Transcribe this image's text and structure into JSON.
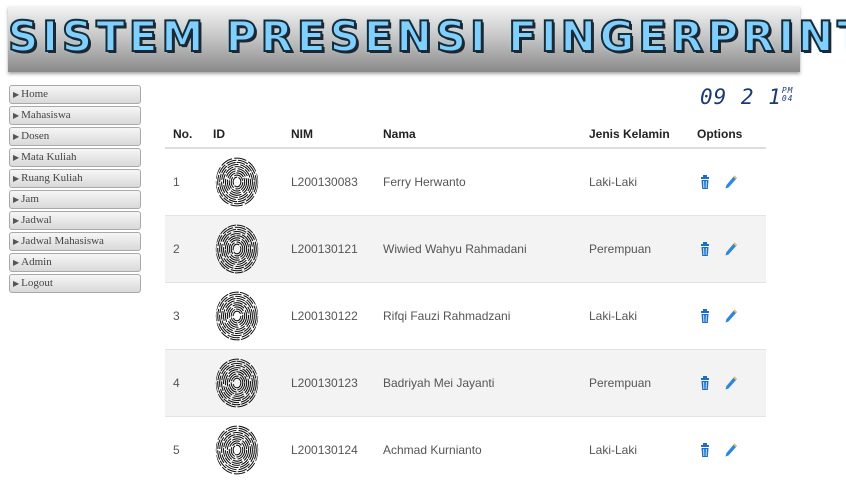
{
  "header": {
    "title": "SISTEM PRESENSI FINGERPRINT"
  },
  "sidebar": {
    "items": [
      {
        "label": "Home"
      },
      {
        "label": "Mahasiswa"
      },
      {
        "label": "Dosen"
      },
      {
        "label": "Mata Kuliah"
      },
      {
        "label": "Ruang Kuliah"
      },
      {
        "label": "Jam"
      },
      {
        "label": "Jadwal"
      },
      {
        "label": "Jadwal Mahasiswa"
      },
      {
        "label": "Admin"
      },
      {
        "label": "Logout"
      }
    ]
  },
  "clock": {
    "time": "09 2 1",
    "ampm": "PM",
    "seconds": "04"
  },
  "table": {
    "columns": [
      "No.",
      "ID",
      "NIM",
      "Nama",
      "Jenis Kelamin",
      "Options"
    ],
    "rows": [
      {
        "no": "1",
        "nim": "L200130083",
        "nama": "Ferry Herwanto",
        "jk": "Laki-Laki"
      },
      {
        "no": "2",
        "nim": "L200130121",
        "nama": "Wiwied Wahyu Rahmadani",
        "jk": "Perempuan"
      },
      {
        "no": "3",
        "nim": "L200130122",
        "nama": "Rifqi Fauzi Rahmadzani",
        "jk": "Laki-Laki"
      },
      {
        "no": "4",
        "nim": "L200130123",
        "nama": "Badriyah Mei Jayanti",
        "jk": "Perempuan"
      },
      {
        "no": "5",
        "nim": "L200130124",
        "nama": "Achmad Kurnianto",
        "jk": "Laki-Laki"
      }
    ]
  },
  "icons": {
    "delete": "trash-icon",
    "edit": "pencil-icon",
    "fingerprint": "fingerprint-image"
  },
  "colors": {
    "accent": "#1a6fc4",
    "clock": "#1c3a72"
  }
}
